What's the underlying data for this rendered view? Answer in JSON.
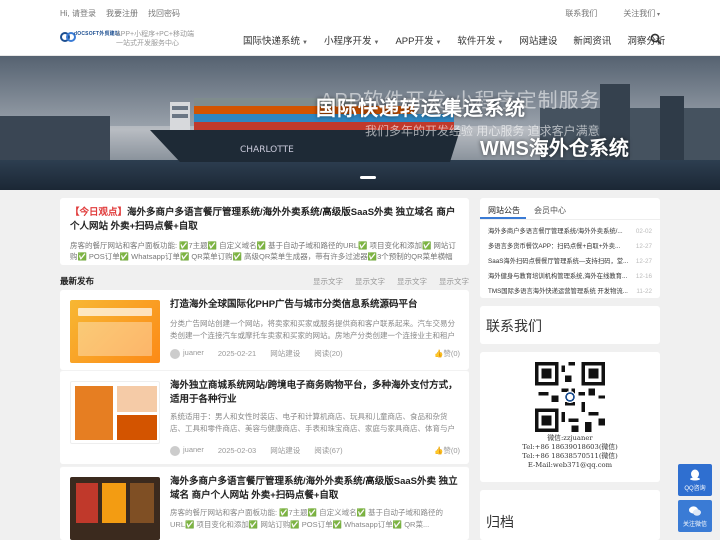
{
  "topbar": {
    "greeting": "Hi, 请登录",
    "register": "我要注册",
    "forgot": "找回密码",
    "bookmark": "联系我们",
    "follow": "关注我们"
  },
  "header": {
    "brand": "dOCSOFT外贸建站",
    "tagline1": "APP+小程序+PC+移动端",
    "tagline2": "一站式开发服务中心",
    "nav": [
      {
        "label": "国际快递系统",
        "dropdown": true
      },
      {
        "label": "小程序开发",
        "dropdown": true
      },
      {
        "label": "APP开发",
        "dropdown": true
      },
      {
        "label": "软件开发",
        "dropdown": true
      },
      {
        "label": "网站建设",
        "dropdown": false
      },
      {
        "label": "新闻资讯",
        "dropdown": false
      },
      {
        "label": "洞察分析",
        "dropdown": false
      }
    ]
  },
  "banner": {
    "text1": "APP软件开发 小程序定制服务",
    "text2": "国际快递转运集运系统",
    "text3": "我们多年的开发经验 用心服务 追求客户满意",
    "text4": "WMS海外仓系统"
  },
  "headline": {
    "tag": "【今日观点】",
    "title": "海外多商户多语言餐厅管理系统/海外外卖系统/高级版SaaS外卖 独立域名 商户个人网站 外卖+扫码点餐+自取",
    "desc": "房客的餐厅网站和客户面板功能: ✅7主题✅ 自定义域名✅ 基于自动子域和路径的URL✅ 项目变化和添加✅ 网站订购✅ POS订单✅ Whatsapp订单✅ QR菜单订购✅ 高级QR菜单生成器，带有许多过滤器✅3个预制的QR菜单横幅模板（PS..."
  },
  "latest": {
    "label": "最新发布",
    "links": [
      "显示文字",
      "显示文字",
      "显示文字",
      "显示文字"
    ]
  },
  "posts": [
    {
      "title": "打造海外全球国际化PHP广告与城市分类信息系统源码平台",
      "desc": "分类广告网站创建一个网站，将卖家和买家或服务提供商和客户联系起来。汽车交易分类创建一个连接汽车或摩托车卖家和买家的网站。房地产分类创建一个连接业主和租户（或买家...",
      "author": "juaner",
      "date": "2025-02-21",
      "category": "网站建设",
      "reads": "阅读(20)",
      "likes": "赞(0)"
    },
    {
      "title": "海外独立商城系统网站/跨境电子商务购物平台，多种海外支付方式，适用于各种行业",
      "desc": "系统适用于：男人和女性时装店、电子和计算机商店、玩具和儿童商店、食品和杂货店、工具和零件商店、美容与健康商店、手表和珠宝商店、家庭与家具商店、体育与户外商店，数...",
      "author": "juaner",
      "date": "2025-02-03",
      "category": "网站建设",
      "reads": "阅读(67)",
      "likes": "赞(0)"
    },
    {
      "title": "海外多商户多语言餐厅管理系统/海外外卖系统/高级版SaaS外卖 独立域名 商户个人网站 外卖+扫码点餐+自取",
      "desc": "房客的餐厅网站和客户面板功能: ✅7主题✅ 自定义域名✅ 基于自动子域和路径的URL✅ 项目变化和添加✅ 网站订购✅ POS订单✅ Whatsapp订单✅ QR菜...",
      "author": "",
      "date": "",
      "category": "",
      "reads": "",
      "likes": ""
    }
  ],
  "sidebar": {
    "tabs": [
      "网站公告",
      "会员中心"
    ],
    "notices": [
      {
        "title": "海外多商户多语言餐厅管理系统/海外外卖系统/...",
        "date": "02-02"
      },
      {
        "title": "多语言多货币餐饮APP：扫码点餐+自取+外卖...",
        "date": "12-27"
      },
      {
        "title": "SaaS海外扫码点餐餐厅管理系统—支持扫码，堂...",
        "date": "12-27"
      },
      {
        "title": "海外健身与教育培训机构管理系统,海外在线教育...",
        "date": "12-16"
      },
      {
        "title": "TMS国际多语言海外快递运营管理系统 开发物流...",
        "date": "11-22"
      }
    ],
    "contact_title": "联系我们",
    "contact_lines": [
      "微信:zzjuaner",
      "Tel:+86 18639018603(微信)",
      "Tel:+86 18638570511(微信)",
      "E-Mail:web371@qq.com"
    ],
    "archive_title": "归档"
  },
  "floating": {
    "qq": "QQ咨询",
    "follow": "关注微信"
  }
}
